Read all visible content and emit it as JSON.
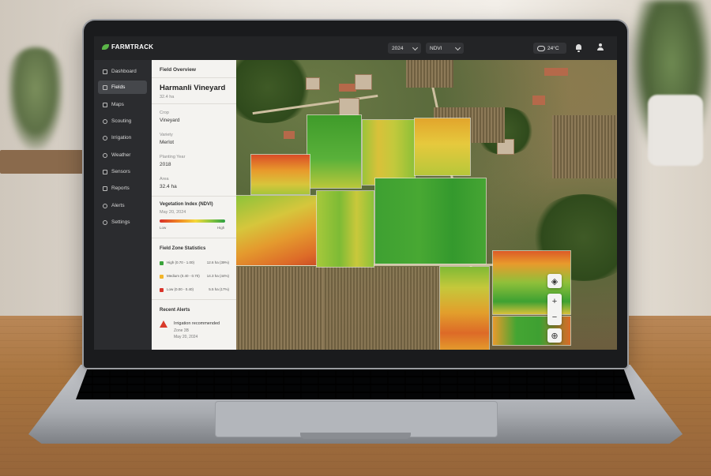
{
  "app": {
    "name": "FARMTRACK"
  },
  "header": {
    "year_select": "2024",
    "index_select": "NDVI",
    "weather": "24°C"
  },
  "sidebar": {
    "items": [
      {
        "label": "Dashboard",
        "icon": "home-icon"
      },
      {
        "label": "Fields",
        "icon": "field-icon",
        "active": true
      },
      {
        "label": "Maps",
        "icon": "map-icon"
      },
      {
        "label": "Scouting",
        "icon": "scouting-icon"
      },
      {
        "label": "Irrigation",
        "icon": "irrigation-icon"
      },
      {
        "label": "Weather",
        "icon": "weather-icon"
      },
      {
        "label": "Sensors",
        "icon": "sensor-icon"
      },
      {
        "label": "Reports",
        "icon": "reports-icon"
      },
      {
        "label": "Alerts",
        "icon": "alerts-icon"
      },
      {
        "label": "Settings",
        "icon": "gear-icon"
      }
    ]
  },
  "panel": {
    "heading": "Field Overview",
    "field_name": "Harmanli Vineyard",
    "field_area": "32.4 ha",
    "crop_label": "Crop",
    "crop_value": "Vineyard",
    "variety_label": "Variety",
    "variety_value": "Merlot",
    "planting_label": "Planting Year",
    "planting_value": "2018",
    "area_label": "Area",
    "area_value": "32.4 ha",
    "ndvi_title": "Vegetation Index (NDVI)",
    "ndvi_date": "May 20, 2024",
    "legend_low": "Low",
    "legend_high": "High",
    "stats_title": "Field Zone Statistics",
    "zones": [
      {
        "name": "High (0.70 - 1.00)",
        "value": "12.6 ha (39%)",
        "color": "#3aa33a"
      },
      {
        "name": "Medium (0.40 - 0.70)",
        "value": "14.3 ha (44%)",
        "color": "#f2b52a"
      },
      {
        "name": "Low (0.00 - 0.40)",
        "value": "5.5 ha (17%)",
        "color": "#d9342a"
      }
    ],
    "alerts_title": "Recent Alerts",
    "alert": {
      "title": "Irrigation recommended",
      "zone": "Zone 3B",
      "date": "May 20, 2024"
    }
  },
  "colors": {
    "brand": "#5bb548",
    "high": "#3aa33a",
    "medium": "#f2b52a",
    "low": "#d9342a"
  }
}
